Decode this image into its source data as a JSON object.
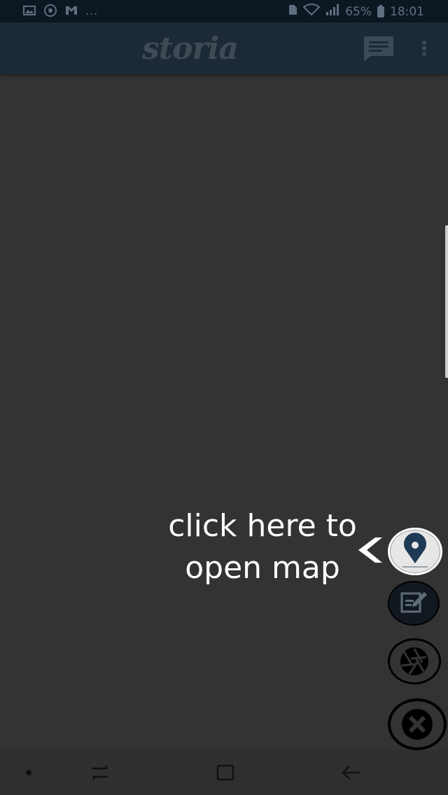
{
  "status_bar": {
    "time": "18:01",
    "battery_text": "65%",
    "overflow_dots": "...",
    "icons": [
      "gallery-icon",
      "soccer-ball-icon",
      "gmail-icon",
      "sim-icon",
      "wifi-icon",
      "signal-icon",
      "battery-icon"
    ]
  },
  "app_bar": {
    "logo_text": "storia",
    "icons": [
      "chat-icon",
      "more-vertical-icon"
    ]
  },
  "overlay": {
    "hint_line1": "click here to",
    "hint_line2": "open map",
    "arrow_icon": "chevron-left-icon"
  },
  "fabs": [
    {
      "name": "map-button",
      "icon": "location-pin-icon"
    },
    {
      "name": "note-button",
      "icon": "edit-note-icon"
    },
    {
      "name": "camera-button",
      "icon": "camera-shutter-icon"
    },
    {
      "name": "close-button",
      "icon": "close-icon"
    }
  ],
  "nav_bar": {
    "icons": [
      "dot-icon",
      "recent-apps-icon",
      "home-icon",
      "back-icon"
    ]
  }
}
